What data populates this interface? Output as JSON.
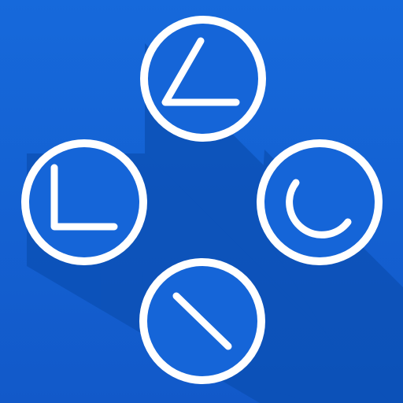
{
  "icon": {
    "background_color": "#1565d8",
    "shadow_color": "#0b4fb3",
    "stroke_color": "#ffffff",
    "buttons": [
      {
        "id": "top",
        "icon": "angle-glyph-icon"
      },
      {
        "id": "left",
        "icon": "l-corner-glyph-icon"
      },
      {
        "id": "right",
        "icon": "arc-glyph-icon"
      },
      {
        "id": "bottom",
        "icon": "diagonal-line-glyph-icon"
      }
    ]
  }
}
